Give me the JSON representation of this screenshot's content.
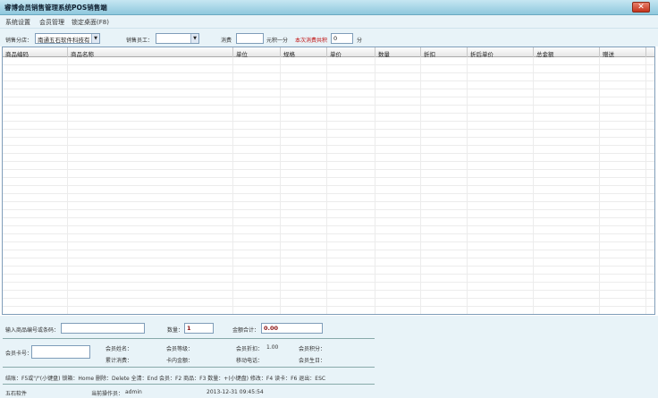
{
  "window": {
    "title": "睿博会员销售管理系统POS销售端"
  },
  "menu": {
    "items": [
      "系统设置",
      "会员管理",
      "锁定桌面(F8)"
    ]
  },
  "toolbar": {
    "branch_label": "销售分店：",
    "branch_value": "南通五石软件科技有",
    "staff_label": "销售员工：",
    "staff_value": "",
    "consume_label": "消费",
    "consume_value": "",
    "points_unit_label": "元积一分",
    "total_points_label": "本次消费共积",
    "total_points_value": "0",
    "points_suffix": "分"
  },
  "table": {
    "columns": [
      "商品编码",
      "商品名称",
      "单位",
      "规格",
      "单价",
      "数量",
      "折扣",
      "折后单价",
      "总金额",
      "赠送"
    ]
  },
  "entry": {
    "product_code_label": "输入商品编号或条码：",
    "product_code_value": "",
    "quantity_label": "数量：",
    "quantity_value": "1",
    "amount_label": "金额合计：",
    "amount_value": "0.00"
  },
  "member": {
    "card_label": "会员卡号：",
    "card_value": "",
    "name_label": "会员姓名：",
    "level_label": "会员等级：",
    "discount_label": "会员折扣：",
    "discount_value": "1.00",
    "points_label": "会员积分：",
    "total_consume_label": "累计消费：",
    "card_balance_label": "卡内金额：",
    "mobile_label": "移动电话：",
    "birthday_label": "会员生日："
  },
  "shortcuts": "结账：F5或\"/\"(小键盘)   锁箱：Home 删除：Delete  全清：End 会员：F2  商品：F3  数量：+(小键盘)  修改：F4  读卡：F6  退出：ESC",
  "status": {
    "company": "五石软件",
    "operator_label": "当前操作员：",
    "operator_value": "admin",
    "datetime": "2013-12-31 09:45:54"
  },
  "colors": {
    "title_bar": "#8ec8dd",
    "panel_bg": "#e8f3f8",
    "close_red": "#c4341c",
    "highlight_red": "#c01010"
  },
  "icons": {
    "close": "close-icon",
    "dropdown": "chevron-down-icon"
  }
}
